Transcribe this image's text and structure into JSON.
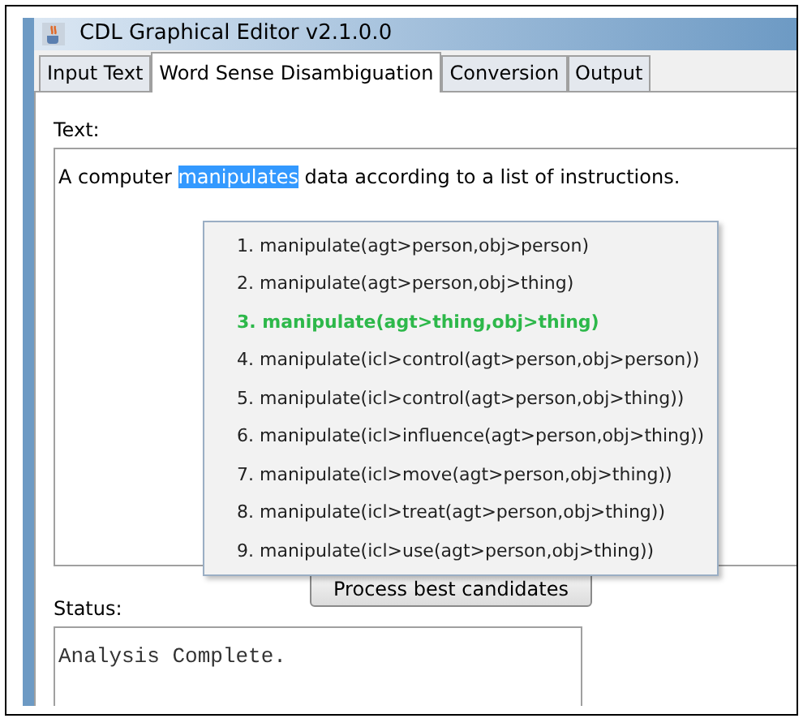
{
  "window": {
    "title": "CDL Graphical Editor v2.1.0.0"
  },
  "tabs": [
    {
      "label": "Input Text",
      "selected": false
    },
    {
      "label": "Word Sense Disambiguation",
      "selected": true
    },
    {
      "label": "Conversion",
      "selected": false
    },
    {
      "label": "Output",
      "selected": false
    }
  ],
  "text_label": "Text:",
  "text_field": {
    "before": "A computer ",
    "selection": "manipulates",
    "after": " data according to a list of instructions."
  },
  "candidates": [
    {
      "label": "1. manipulate(agt>person,obj>person)",
      "selected": false
    },
    {
      "label": "2. manipulate(agt>person,obj>thing)",
      "selected": false
    },
    {
      "label": "3. manipulate(agt>thing,obj>thing)",
      "selected": true
    },
    {
      "label": "4. manipulate(icl>control(agt>person,obj>person))",
      "selected": false
    },
    {
      "label": "5. manipulate(icl>control(agt>person,obj>thing))",
      "selected": false
    },
    {
      "label": "6. manipulate(icl>influence(agt>person,obj>thing))",
      "selected": false
    },
    {
      "label": "7. manipulate(icl>move(agt>person,obj>thing))",
      "selected": false
    },
    {
      "label": "8. manipulate(icl>treat(agt>person,obj>thing))",
      "selected": false
    },
    {
      "label": "9. manipulate(icl>use(agt>person,obj>thing))",
      "selected": false
    }
  ],
  "process_button": "Process best candidates",
  "status_label": "Status:",
  "status_text": "Analysis Complete."
}
